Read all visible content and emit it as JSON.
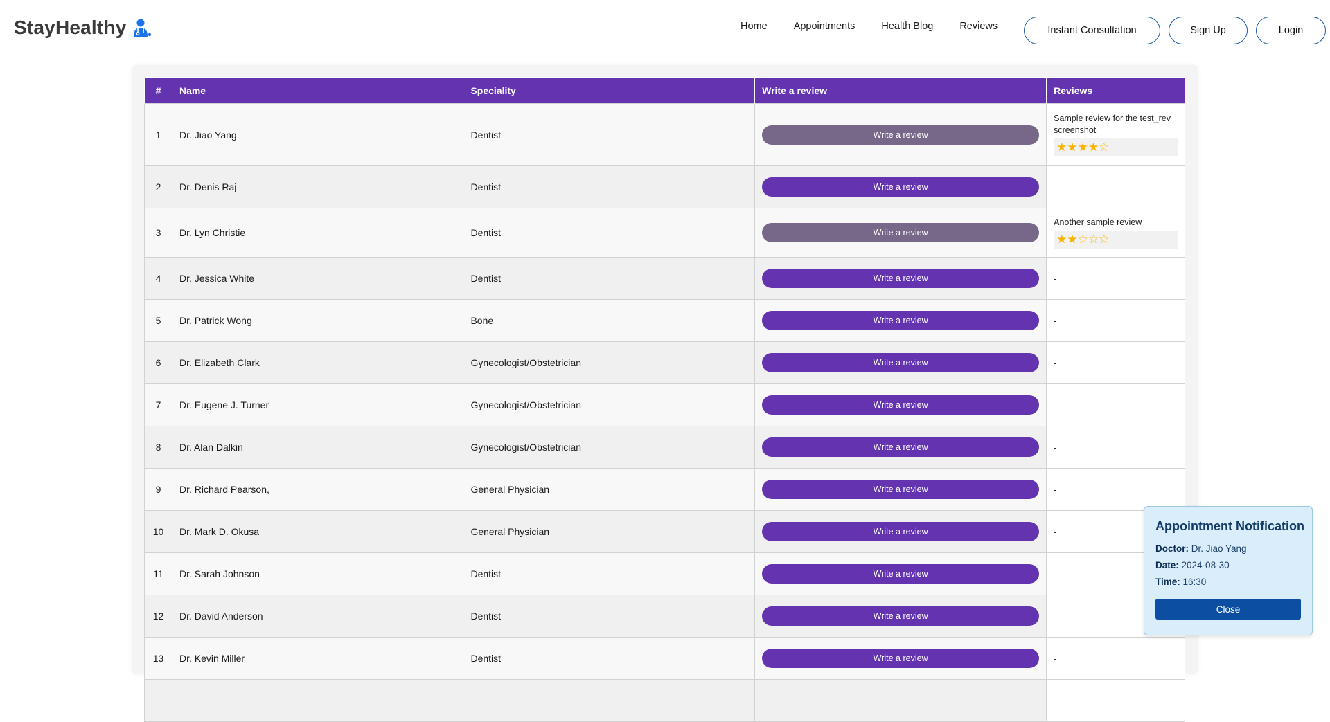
{
  "header": {
    "brand": "StayHealthy",
    "brand_icon": "doctor-icon",
    "nav": [
      "Home",
      "Appointments",
      "Health Blog",
      "Reviews"
    ],
    "buttons": {
      "consult": "Instant Consultation",
      "signup": "Sign Up",
      "login": "Login"
    }
  },
  "table": {
    "headers": [
      "#",
      "Name",
      "Speciality",
      "Write a review",
      "Reviews"
    ],
    "button_label": "Write a review",
    "empty_review": "-",
    "rows": [
      {
        "num": "1",
        "name": "Dr. Jiao Yang",
        "speciality": "Dentist",
        "reviewed": true,
        "review_text": "Sample review for the test_rev screenshot",
        "rating": 4,
        "stars": "★★★★☆"
      },
      {
        "num": "2",
        "name": "Dr. Denis Raj",
        "speciality": "Dentist",
        "reviewed": false
      },
      {
        "num": "3",
        "name": "Dr. Lyn Christie",
        "speciality": "Dentist",
        "reviewed": true,
        "review_text": "Another sample review",
        "rating": 2,
        "stars": "★★☆☆☆"
      },
      {
        "num": "4",
        "name": "Dr. Jessica White",
        "speciality": "Dentist",
        "reviewed": false
      },
      {
        "num": "5",
        "name": "Dr. Patrick Wong",
        "speciality": "Bone",
        "reviewed": false
      },
      {
        "num": "6",
        "name": "Dr. Elizabeth Clark",
        "speciality": "Gynecologist/Obstetrician",
        "reviewed": false
      },
      {
        "num": "7",
        "name": "Dr. Eugene J. Turner",
        "speciality": "Gynecologist/Obstetrician",
        "reviewed": false
      },
      {
        "num": "8",
        "name": "Dr. Alan Dalkin",
        "speciality": "Gynecologist/Obstetrician",
        "reviewed": false
      },
      {
        "num": "9",
        "name": "Dr. Richard Pearson,",
        "speciality": "General Physician",
        "reviewed": false
      },
      {
        "num": "10",
        "name": "Dr. Mark D. Okusa",
        "speciality": "General Physician",
        "reviewed": false
      },
      {
        "num": "11",
        "name": "Dr. Sarah Johnson",
        "speciality": "Dentist",
        "reviewed": false
      },
      {
        "num": "12",
        "name": "Dr. David Anderson",
        "speciality": "Dentist",
        "reviewed": false
      },
      {
        "num": "13",
        "name": "Dr. Kevin Miller",
        "speciality": "Dentist",
        "reviewed": false
      },
      {
        "num": "",
        "name": "",
        "speciality": "",
        "reviewed": false,
        "partial": true
      }
    ]
  },
  "notification": {
    "title": "Appointment Notification",
    "doctor_label": "Doctor:",
    "doctor": "Dr. Jiao Yang",
    "date_label": "Date:",
    "date": "2024-08-30",
    "time_label": "Time:",
    "time": "16:30",
    "close": "Close"
  },
  "colors": {
    "primary": "#6434b0",
    "disabled_button": "#776789",
    "star": "#f5b400",
    "notification_bg": "#d9eefa",
    "close_button": "#0b4ea2",
    "nav_button_border": "#1a56a8"
  }
}
